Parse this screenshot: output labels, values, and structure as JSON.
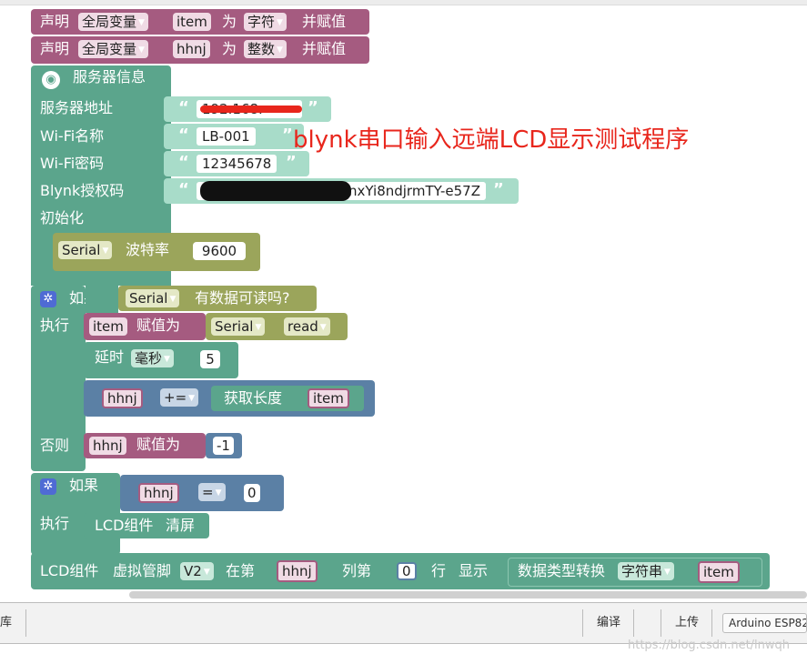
{
  "decl": [
    {
      "kw": "声明",
      "scope": "全局变量",
      "name": "item",
      "as": "为",
      "type": "字符",
      "assign": "并赋值"
    },
    {
      "kw": "声明",
      "scope": "全局变量",
      "name": "hhnj",
      "as": "为",
      "type": "整数",
      "assign": "并赋值"
    }
  ],
  "server": {
    "title": "服务器信息",
    "rows": [
      {
        "label": "服务器地址",
        "value": "192.168.",
        "redacted": true
      },
      {
        "label": "Wi-Fi名称",
        "value": "LB-001"
      },
      {
        "label": "Wi-Fi密码",
        "value": "12345678"
      },
      {
        "label": "Blynk授权码",
        "value": "nxYi8ndjrmTY-e57Z",
        "redacted": true
      }
    ],
    "init_label": "初始化",
    "serial": "Serial",
    "baud_label": "波特率",
    "baud": "9600"
  },
  "annotation": "blynk串口输入远端LCD显示测试程序",
  "if1": {
    "if_kw": "如果",
    "serial": "Serial",
    "readable": "有数据可读吗?",
    "do_kw": "执行",
    "var": "item",
    "assign": "赋值为",
    "serial2": "Serial",
    "method": "read",
    "delay_kw": "延时",
    "unit": "毫秒",
    "delay": "5",
    "var2": "hhnj",
    "op": "+=",
    "len_kw": "获取长度",
    "len_var": "item",
    "else_kw": "否则",
    "else_var": "hhnj",
    "else_assign": "赋值为",
    "else_val": "-1"
  },
  "if2": {
    "if_kw": "如果",
    "var": "hhnj",
    "op": "=",
    "val": "0",
    "do_kw": "执行",
    "lcd": "LCD组件",
    "clear": "清屏"
  },
  "lcd": {
    "lcd": "LCD组件",
    "pin_label": "虚拟管脚",
    "pin": "V2",
    "at": "在第",
    "col_var": "hhnj",
    "col": "列第",
    "row": "0",
    "row_kw": "行",
    "show": "显示",
    "conv": "数据类型转换",
    "str_type": "字符串",
    "var": "item"
  },
  "toolbar": {
    "left": "库",
    "compile": "编译",
    "upload": "上传",
    "board": "Arduino ESP82"
  },
  "watermark": "https://blog.csdn.net/lnwqh",
  "colors": {
    "var": "#a55b80",
    "server": "#5ba58c",
    "logic": "#5b80a5",
    "text": "#9ba55b",
    "accent": "#e8261c"
  }
}
